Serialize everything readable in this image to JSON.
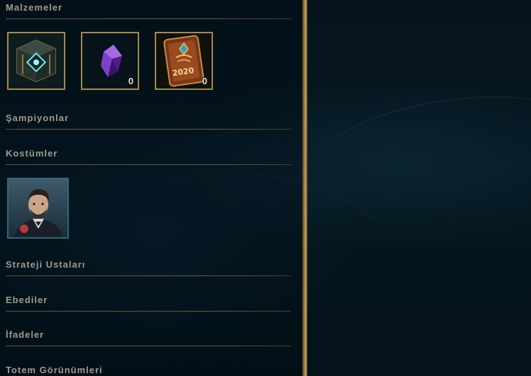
{
  "sections": {
    "materials": {
      "title": "Malzemeler"
    },
    "champions": {
      "title": "Şampiyonlar"
    },
    "skins": {
      "title": "Kostümler"
    },
    "tactics": {
      "title": "Strateji Ustaları"
    },
    "eternals": {
      "title": "Ebediler"
    },
    "emotes": {
      "title": "İfadeler"
    },
    "wards": {
      "title": "Totem Görünümleri"
    }
  },
  "materials": {
    "items": [
      {
        "icon": "hextech-chest-icon",
        "count": ""
      },
      {
        "icon": "purple-gem-icon",
        "count": "0"
      },
      {
        "icon": "event-token-2020-icon",
        "count": "0",
        "badge": "2020"
      }
    ]
  },
  "skins": {
    "items": [
      {
        "icon": "champion-skin-portrait"
      }
    ]
  },
  "colors": {
    "gold_border": "#a58a4d",
    "section_text": "#a09b8c",
    "divider_gold": "#c8aa6e"
  }
}
